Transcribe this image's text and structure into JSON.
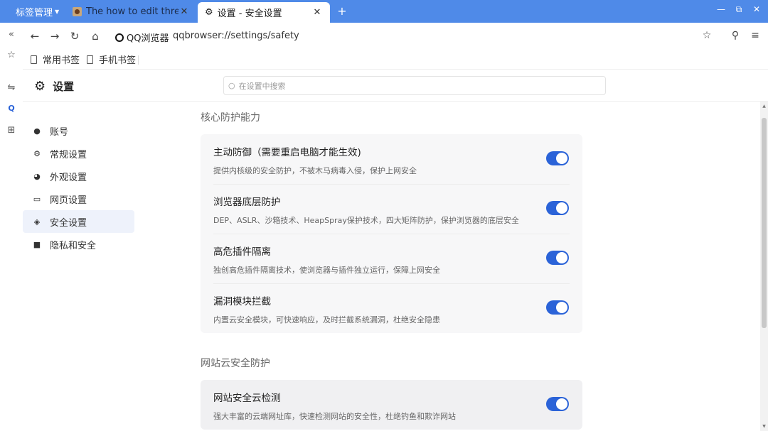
{
  "titlebar": {
    "tab_group_label": "标签管理",
    "tabs": [
      {
        "label": "The how to edit thread",
        "close": "✕"
      },
      {
        "label": "设置 - 安全设置",
        "close": "✕"
      }
    ],
    "new_tab": "+",
    "window_controls": {
      "minimize": "—",
      "restore": "⧉",
      "close": "✕"
    }
  },
  "address_bar": {
    "site_name": "QQ浏览器",
    "url": "qqbrowser://settings/safety"
  },
  "bookmarks": [
    {
      "label": "常用书签"
    },
    {
      "label": "手机书签"
    }
  ],
  "settings_header": {
    "title": "设置",
    "search_placeholder": "在设置中搜索"
  },
  "sidebar": {
    "items": [
      {
        "label": "账号",
        "icon": "person-icon"
      },
      {
        "label": "常规设置",
        "icon": "gear-icon"
      },
      {
        "label": "外观设置",
        "icon": "palette-icon"
      },
      {
        "label": "网页设置",
        "icon": "webpage-icon"
      },
      {
        "label": "安全设置",
        "icon": "shield-icon",
        "active": true
      },
      {
        "label": "隐私和安全",
        "icon": "lock-icon"
      }
    ]
  },
  "sections": [
    {
      "title": "核心防护能力",
      "rows": [
        {
          "title": "主动防御（需要重启电脑才能生效)",
          "desc": "提供内核级的安全防护，不被木马病毒入侵，保护上网安全",
          "enabled": true
        },
        {
          "title": "浏览器底层防护",
          "desc": "DEP、ASLR、沙箱技术、HeapSpray保护技术，四大矩阵防护，保护浏览器的底层安全",
          "enabled": true
        },
        {
          "title": "高危插件隔离",
          "desc": "独创高危插件隔离技术，使浏览器与插件独立运行，保障上网安全",
          "enabled": true
        },
        {
          "title": "漏洞模块拦截",
          "desc": "内置云安全模块，可快速响应，及时拦截系统漏洞，杜绝安全隐患",
          "enabled": true
        }
      ]
    },
    {
      "title": "网站云安全防护",
      "rows": [
        {
          "title": "网站安全云检测",
          "desc": "强大丰富的云端网址库，快速检测网站的安全性，杜绝钓鱼和欺诈网站",
          "enabled": true
        }
      ]
    }
  ],
  "colors": {
    "accent": "#2b63d8",
    "titlebar": "#4f8ae8"
  }
}
